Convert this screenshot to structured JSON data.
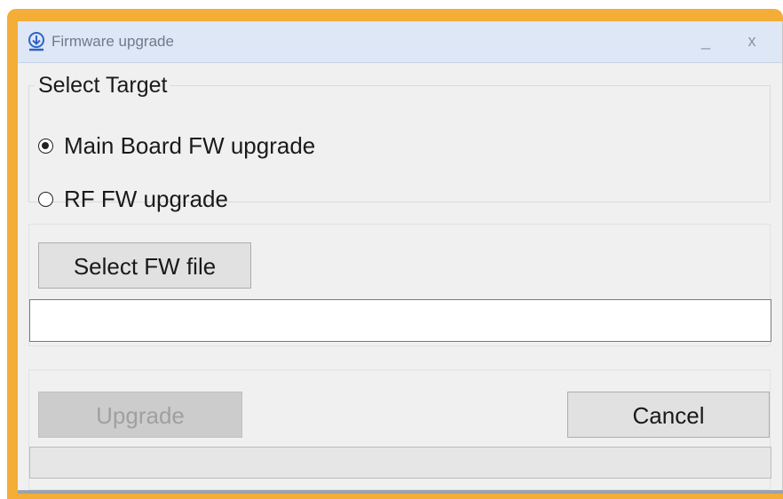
{
  "window": {
    "title": "Firmware upgrade",
    "minimize_glyph": "_",
    "close_glyph": "x"
  },
  "target_group": {
    "legend": "Select Target",
    "options": [
      {
        "label": "Main Board FW upgrade",
        "checked": true
      },
      {
        "label": "RF FW upgrade",
        "checked": false
      }
    ]
  },
  "file_section": {
    "select_button_label": "Select FW file",
    "file_path_value": ""
  },
  "actions": {
    "upgrade_label": "Upgrade",
    "upgrade_enabled": false,
    "cancel_label": "Cancel",
    "progress_percent": 0
  },
  "icons": {
    "title_icon": "download-icon"
  },
  "colors": {
    "frame_accent": "#f4ad36",
    "titlebar_bg": "#dde7f5",
    "icon_blue": "#2f63c9"
  }
}
